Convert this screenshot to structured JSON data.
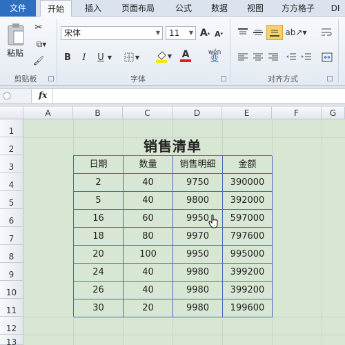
{
  "tabs": [
    "文件",
    "开始",
    "插入",
    "页面布局",
    "公式",
    "数据",
    "视图",
    "方方格子",
    "DI"
  ],
  "ribbon": {
    "clipboard": {
      "paste_label": "粘贴",
      "group_label": "剪贴板"
    },
    "font": {
      "font_name": "宋体",
      "font_size": "11",
      "bold": "B",
      "italic": "I",
      "underline": "U",
      "grow": "A",
      "shrink": "A",
      "fontcolor": "A",
      "phonetic": "wén",
      "phonetic2": "变",
      "group_label": "字体"
    },
    "align": {
      "group_label": "对齐方式"
    }
  },
  "formula_bar": {
    "fx": "fx"
  },
  "columns": [
    "A",
    "B",
    "C",
    "D",
    "E",
    "F",
    "G"
  ],
  "rows": [
    "1",
    "2",
    "3",
    "4",
    "5",
    "6",
    "7",
    "8",
    "9",
    "10",
    "11",
    "12",
    "13"
  ],
  "sheet": {
    "title": "销售清单",
    "headers": [
      "日期",
      "数量",
      "销售明细",
      "金额"
    ],
    "data": [
      [
        "2",
        "40",
        "9750",
        "390000"
      ],
      [
        "5",
        "40",
        "9800",
        "392000"
      ],
      [
        "16",
        "60",
        "9950",
        "597000"
      ],
      [
        "18",
        "80",
        "9970",
        "797600"
      ],
      [
        "20",
        "100",
        "9950",
        "995000"
      ],
      [
        "24",
        "40",
        "9980",
        "399200"
      ],
      [
        "26",
        "40",
        "9980",
        "399200"
      ],
      [
        "30",
        "20",
        "9980",
        "199600"
      ]
    ]
  },
  "colors": {
    "file_tab": "#2e6ec0",
    "sheet_bg": "#d8e7d3",
    "table_border": "#4a66c0",
    "highlight": "#f5c842",
    "font_red": "#e02020"
  }
}
